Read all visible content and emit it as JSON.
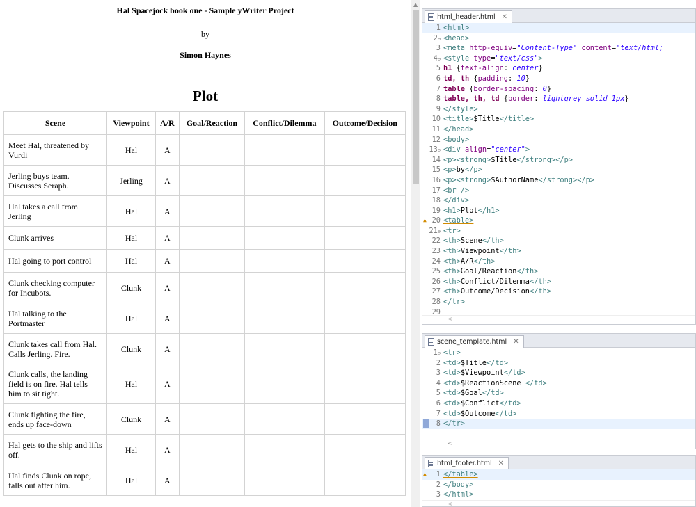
{
  "preview": {
    "title": "Hal Spacejock book one - Sample yWriter Project",
    "by": "by",
    "author": "Simon Haynes",
    "heading": "Plot",
    "columns": [
      "Scene",
      "Viewpoint",
      "A/R",
      "Goal/Reaction",
      "Conflict/Dilemma",
      "Outcome/Decision"
    ],
    "rows": [
      {
        "scene": "Meet Hal, threatened by Vurdi",
        "viewpoint": "Hal",
        "ar": "A"
      },
      {
        "scene": "Jerling buys team. Discusses Seraph.",
        "viewpoint": "Jerling",
        "ar": "A"
      },
      {
        "scene": "Hal takes a call from Jerling",
        "viewpoint": "Hal",
        "ar": "A"
      },
      {
        "scene": "Clunk arrives",
        "viewpoint": "Hal",
        "ar": "A"
      },
      {
        "scene": "Hal going to port control",
        "viewpoint": "Hal",
        "ar": "A"
      },
      {
        "scene": "Clunk checking computer for Incubots.",
        "viewpoint": "Clunk",
        "ar": "A"
      },
      {
        "scene": "Hal talking to the Portmaster",
        "viewpoint": "Hal",
        "ar": "A"
      },
      {
        "scene": "Clunk takes call from Hal. Calls Jerling. Fire.",
        "viewpoint": "Clunk",
        "ar": "A"
      },
      {
        "scene": "Clunk calls, the landing field is on fire. Hal tells him to sit tight.",
        "viewpoint": "Hal",
        "ar": "A"
      },
      {
        "scene": "Clunk fighting the fire, ends up face-down",
        "viewpoint": "Clunk",
        "ar": "A"
      },
      {
        "scene": "Hal gets to the ship and lifts off.",
        "viewpoint": "Hal",
        "ar": "A"
      },
      {
        "scene": "Hal finds Clunk on rope, falls out after him.",
        "viewpoint": "Hal",
        "ar": "A"
      }
    ]
  },
  "editors": {
    "header": {
      "tab": "html_header.html",
      "close": "✕",
      "lines": [
        {
          "n": "1",
          "t": "<html>"
        },
        {
          "n": "2",
          "t": "<head>"
        },
        {
          "n": "3",
          "t": "<meta http-equiv=\"Content-Type\" content=\"text/html;"
        },
        {
          "n": "4",
          "t": "<style type=\"text/css\">"
        },
        {
          "n": "5",
          "t": "h1 {text-align: center}"
        },
        {
          "n": "6",
          "t": "td, th {padding: 10}"
        },
        {
          "n": "7",
          "t": "table {border-spacing: 0}"
        },
        {
          "n": "8",
          "t": "table, th, td {border: lightgrey solid 1px}"
        },
        {
          "n": "9",
          "t": "</style>"
        },
        {
          "n": "10",
          "t": "<title>$Title</title>"
        },
        {
          "n": "11",
          "t": "</head>"
        },
        {
          "n": "12",
          "t": "<body>"
        },
        {
          "n": "13",
          "t": "<div align=\"center\">"
        },
        {
          "n": "14",
          "t": "<p><strong>$Title</strong></p>"
        },
        {
          "n": "15",
          "t": "<p>by</p>"
        },
        {
          "n": "16",
          "t": "<p><strong>$AuthorName</strong></p>"
        },
        {
          "n": "17",
          "t": "<br />"
        },
        {
          "n": "18",
          "t": "</div>"
        },
        {
          "n": "19",
          "t": "<h1>Plot</h1>"
        },
        {
          "n": "20",
          "t": "<table>"
        },
        {
          "n": "21",
          "t": "<tr>"
        },
        {
          "n": "22",
          "t": "<th>Scene</th>"
        },
        {
          "n": "23",
          "t": "<th>Viewpoint</th>"
        },
        {
          "n": "24",
          "t": "<th>A/R</th>"
        },
        {
          "n": "25",
          "t": "<th>Goal/Reaction</th>"
        },
        {
          "n": "26",
          "t": "<th>Conflict/Dilemma</th>"
        },
        {
          "n": "27",
          "t": "<th>Outcome/Decision</th>"
        },
        {
          "n": "28",
          "t": "</tr>"
        },
        {
          "n": "29",
          "t": ""
        }
      ]
    },
    "scene": {
      "tab": "scene_template.html",
      "close": "✕",
      "lines": [
        {
          "n": "1",
          "t": "<tr>"
        },
        {
          "n": "2",
          "t": "<td>$Title</td>"
        },
        {
          "n": "3",
          "t": "<td>$Viewpoint</td>"
        },
        {
          "n": "4",
          "t": "<td>$ReactionScene </td>"
        },
        {
          "n": "5",
          "t": "<td>$Goal</td>"
        },
        {
          "n": "6",
          "t": "<td>$Conflict</td>"
        },
        {
          "n": "7",
          "t": "<td>$Outcome</td>"
        },
        {
          "n": "8",
          "t": "</tr>"
        }
      ]
    },
    "footer": {
      "tab": "html_footer.html",
      "close": "✕",
      "lines": [
        {
          "n": "1",
          "t": "</table>"
        },
        {
          "n": "2",
          "t": "</body>"
        },
        {
          "n": "3",
          "t": "</html>"
        }
      ]
    }
  },
  "colors": {
    "tag": "#3f7f7f",
    "attribute": "#7f007f",
    "attr_value": "#2a00ff",
    "css_selector": "#7f0055",
    "line_highlight": "#e8f2fe",
    "warning": "#d28b00"
  }
}
